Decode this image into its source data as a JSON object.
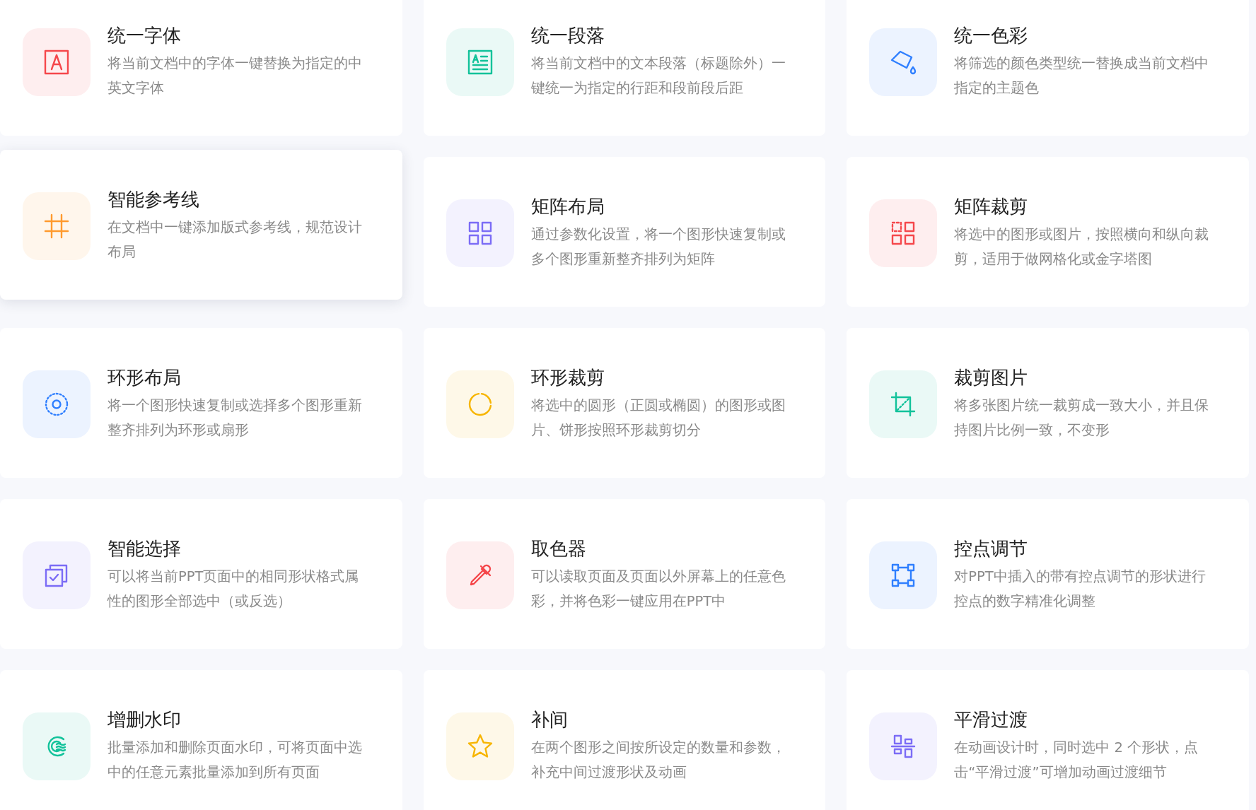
{
  "cards": [
    {
      "kind": "font",
      "color": "#f5474b",
      "raised": false,
      "title": "统一字体",
      "desc": [
        "将当前文档中的字体一键替换为指定的中",
        "英文字体"
      ]
    },
    {
      "kind": "paragraph",
      "color": "#12c29a",
      "raised": false,
      "title": "统一段落",
      "desc": [
        "将当前文档中的文本段落（标题除外）一",
        "键统一为指定的行距和段前段后距"
      ]
    },
    {
      "kind": "bucket",
      "color": "#2f7fff",
      "raised": false,
      "title": "统一色彩",
      "desc": [
        "将筛选的颜色类型统一替换成当前文档中",
        "指定的主题色"
      ]
    },
    {
      "kind": "guides",
      "color": "#ff9a2e",
      "raised": true,
      "title": "智能参考线",
      "desc": [
        "在文档中一键添加版式参考线，规范设计",
        "布局"
      ]
    },
    {
      "kind": "matrix",
      "color": "#7b6cf6",
      "raised": false,
      "title": "矩阵布局",
      "desc": [
        "通过参数化设置，将一个图形快速复制或",
        "多个图形重新整齐排列为矩阵"
      ]
    },
    {
      "kind": "matrix-crop",
      "color": "#f5474b",
      "raised": false,
      "title": "矩阵裁剪",
      "desc": [
        "将选中的图形或图片，按照横向和纵向裁",
        "剪，适用于做网格化或金字塔图"
      ]
    },
    {
      "kind": "ring",
      "color": "#2f7fff",
      "raised": false,
      "title": "环形布局",
      "desc": [
        "将一个图形快速复制或选择多个图形重新",
        "整齐排列为环形或扇形"
      ]
    },
    {
      "kind": "ring-crop",
      "color": "#f7b500",
      "raised": false,
      "title": "环形裁剪",
      "desc": [
        "将选中的圆形（正圆或椭圆）的图形或图",
        "片、饼形按照环形裁剪切分"
      ]
    },
    {
      "kind": "crop",
      "color": "#12c29a",
      "raised": false,
      "title": "裁剪图片",
      "desc": [
        "将多张图片统一裁剪成一致大小，并且保",
        "持图片比例一致，不变形"
      ]
    },
    {
      "kind": "select",
      "color": "#7b6cf6",
      "raised": false,
      "title": "智能选择",
      "desc": [
        "可以将当前PPT页面中的相同形状格式属",
        "性的图形全部选中（或反选）"
      ]
    },
    {
      "kind": "eyedropper",
      "color": "#f5474b",
      "raised": false,
      "title": "取色器",
      "desc": [
        "可以读取页面及页面以外屏幕上的任意色",
        "彩，并将色彩一键应用在PPT中"
      ]
    },
    {
      "kind": "nodes",
      "color": "#2f7fff",
      "raised": false,
      "title": "控点调节",
      "desc": [
        "对PPT中插入的带有控点调节的形状进行",
        "控点的数字精准化调整"
      ]
    },
    {
      "kind": "watermark",
      "color": "#12c29a",
      "raised": false,
      "title": "增删水印",
      "desc": [
        "批量添加和删除页面水印，可将页面中选",
        "中的任意元素批量添加到所有页面"
      ]
    },
    {
      "kind": "star",
      "color": "#f7b500",
      "raised": false,
      "title": "补间",
      "desc": [
        "在两个图形之间按所设定的数量和参数，",
        "补充中间过渡形状及动画"
      ]
    },
    {
      "kind": "align",
      "color": "#7b6cf6",
      "raised": false,
      "title": "平滑过渡",
      "desc": [
        "在动画设计时，同时选中 2 个形状，点",
        "击“平滑过渡”可增加动画过渡细节"
      ]
    }
  ]
}
